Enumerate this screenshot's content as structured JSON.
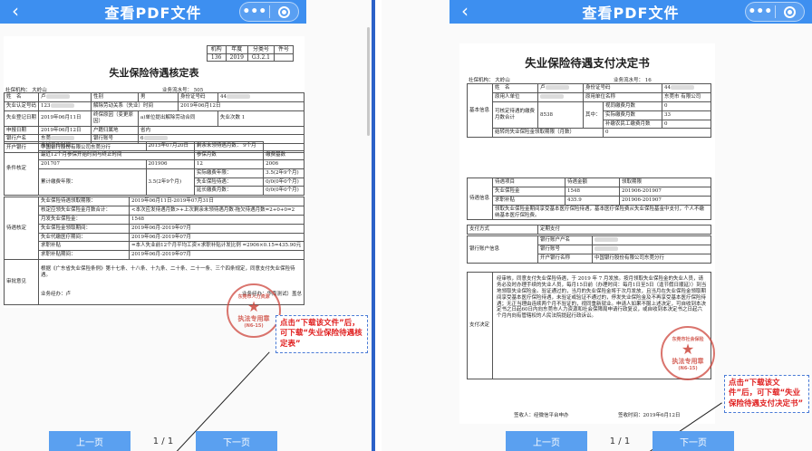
{
  "left": {
    "titlebar": {
      "title": "查看PDF文件",
      "back": "‹",
      "more": "•••"
    },
    "doc": {
      "code_headers": [
        "机构",
        "年度",
        "分类号",
        "件号"
      ],
      "code_values": [
        "136",
        "2019",
        "G3.2.1",
        ""
      ],
      "title": "失业保险待遇核定表",
      "agency": "社保机构：    大岭山",
      "biz_no": "业务流水号：           505",
      "rows": [
        [
          "姓　名",
          "卢",
          "性别",
          "男",
          "身份证号码",
          "44"
        ],
        [
          "失业认定号码",
          "123",
          "解除劳动关系（失业）时间",
          "",
          "2019年06月12日",
          ""
        ],
        [
          "失业登记日期",
          "2019年06月11日",
          "终保原因（变更原因）",
          "a)单位提出解除劳动合同",
          "失业次数",
          "1"
        ],
        [
          "申报日期",
          "2019年06月12日",
          "户籍归属地",
          "",
          "省内",
          ""
        ],
        [
          "银行户名",
          "东莞",
          "银行账号",
          "6",
          "",
          ""
        ],
        [
          "开户银行",
          "中国银行股份有限公司东莞分行",
          "",
          "",
          "",
          ""
        ]
      ],
      "section_condition": "条件核定",
      "cond_rows": [
        [
          "参加工作时间：",
          "2015年07月20日",
          "剩余未领待遇月数：",
          "9个月"
        ],
        [
          "最近12个月参保开始时间与终止时间",
          "",
          "参保月数",
          "缴费基数"
        ],
        [
          "201707",
          "201906",
          "12",
          "2006"
        ],
        [
          "累计缴费年限：",
          "3.5(2年9个月)",
          "实际缴费年限：",
          "3.5(2年9个月)"
        ],
        [
          "",
          "",
          "失业保险待遇：",
          "0/0(0年0个月)"
        ],
        [
          "",
          "",
          "延长缴费月数：",
          "0/0(0年0个月)"
        ]
      ],
      "section_benefit": "待遇核定",
      "benefit_rows": [
        [
          "失业保险待遇领取期限：",
          "2019年06月11日-2019年07月31日"
        ],
        [
          "核定应领失业保险金月数合计：",
          "<本次应发待遇月数>+上次剩余未领待遇月数-拖欠待遇月数=2+0+0=2"
        ],
        [
          "月发失业保险金：",
          "1548"
        ],
        [
          "失业保险金领取期间：",
          "2019年06月-2019年07月"
        ],
        [
          "失业代缴医疗期间：",
          "2019年06月-2019年07月"
        ],
        [
          "求职补贴",
          "=本人失业前12个月平均工资×求职补贴计发比例 =2906×0.15=435.90元"
        ],
        [
          "求职补贴期间：",
          "2019年06月-2019年07月"
        ]
      ],
      "section_audit": "审批意见",
      "audit_text": "根据《广东省失业保险条例》第十七条、十八条、十九条、二十条、二十一条、三个四条规定，同意支付失业保险待遇。",
      "handler": "业务经办：卢",
      "agency_sign": "业务经办：华南测试）盖总"
    },
    "stamp": {
      "line1": "东莞市人力资源",
      "line2": "执法专用章",
      "code": "(N6-15)"
    },
    "callout": "点击“下载该文件”后，可下载“失业保险待遇核定表”",
    "pager": {
      "prev": "上一页",
      "page": "1  /  1",
      "next": "下一页"
    }
  },
  "right": {
    "titlebar": {
      "title": "查看PDF文件",
      "back": "‹",
      "more": "•••"
    },
    "doc": {
      "title": "失业保险待遇支付决定书",
      "agency": "社保机构：    大岭山",
      "biz_no": "业务流水号：    16",
      "section_basic": "基本信息",
      "basic_rows": [
        [
          "姓　名",
          "卢",
          "身份证号码",
          "44"
        ],
        [
          "原用人单位",
          "",
          "原用单位名称",
          "东莞市          有限公司"
        ],
        [
          "可核定待遇的缴费月数合计",
          "8538",
          "其中：",
          "视同缴费月数",
          "0"
        ],
        [
          "",
          "",
          "",
          "实际缴费月数",
          "33"
        ],
        [
          "",
          "",
          "",
          "补缴农民工缴费月数",
          "0"
        ],
        [
          "结转的失业保险金领取期限（月数）",
          "0"
        ]
      ],
      "section_benefit": "待遇信息",
      "benefit_head": [
        "待遇项目",
        "待遇金额",
        "领取期限"
      ],
      "benefit_rows": [
        [
          "失业保险金",
          "1548",
          "201906-201907"
        ],
        [
          "求职补贴",
          "435.9",
          "201906-201907"
        ]
      ],
      "benefit_note": "领取失业保险金期间享受基本医疗保险待遇，基本医疗保险费从失业保险基金中支付，个人不缴纳基本医疗保险费。",
      "pay_way_label": "支付方式",
      "pay_way": "定期支付",
      "section_bank": "银行账户信息",
      "bank_rows": [
        [
          "银行账户户名",
          ""
        ],
        [
          "银行账号",
          ""
        ],
        [
          "开户银行名称",
          "中国银行股份有限公司东莞分行"
        ]
      ],
      "decision_label": "支付决定",
      "decision_text": "经审核，同意支付失业保险待遇，于 2019 年 7 月发放。按月领取失业保险金的失业人员，请务必及时办理手续的失业人员，每月15日前（办理时间：每月1日至5日（逢节假日顺延））到当地领取失业保险金。验证通过的，当月的失业保险金将于次月发放，且当月在失业保险金领取期间享受基本医疗保险待遇，未验证或验证不通过的，停发失业保险金及不再享受基本医疗保险待遇；无正当理由连续两个月不验证的，视同重新就业。申请人如果不服上述决定，可自收到本决定书之日起60日内向东莞市人力资源和社会保障局申请行政复议，或自收到本决定书之日起六个月内向有管辖权的人民法院提起行政诉讼。",
      "sign_left": "签收人：经微信平台申办",
      "sign_right": "签收时间：2019年6月12日"
    },
    "stamp": {
      "line1": "东莞市社会保险",
      "line2": "执法专用章",
      "code": "(N6-15)"
    },
    "callout": "点击“下载该文件”后，可下载“失业保险待遇支付决定书”",
    "pager": {
      "prev": "上一页",
      "page": "1  /  1",
      "next": "下一页"
    }
  }
}
